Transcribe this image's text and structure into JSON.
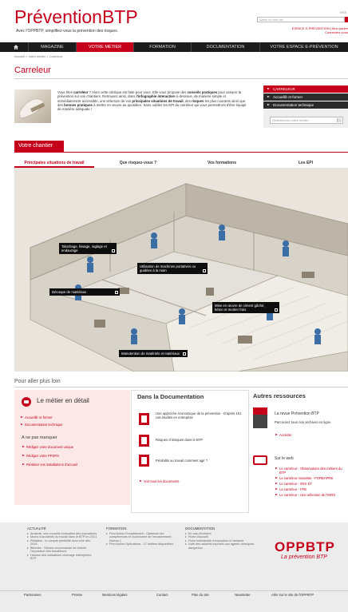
{
  "header": {
    "logo": "PréventionBTP",
    "tagline": "Avec l'OPPBTP, simplifiez-vous la prévention des risques.",
    "user_text": "RSS",
    "search_placeholder": "Saisir un mot clé",
    "link_espace": "ESPACE E-PRÉVENTION",
    "link_mon_panier": "Mon panier",
    "link_connectez": "Connectez-vous"
  },
  "nav": {
    "items": [
      {
        "label": ""
      },
      {
        "label": "MAGAZINE"
      },
      {
        "label": "VOTRE MÉTIER"
      },
      {
        "label": "FORMATION"
      },
      {
        "label": "DOCUMENTATION"
      },
      {
        "label": "VOTRE ESPACE E-PRÉVENTION"
      }
    ],
    "active_color": "#c5001b"
  },
  "breadcrumb": "Accueil > Votre métier > Carreleur",
  "page_title": "Carreleur",
  "intro": {
    "p1": "Vous êtes ",
    "b1": "carreleur",
    "p2": " ? Alors cette rubrique est faite pour vous. Elle vous propose des ",
    "b2": "conseils pratiques",
    "p3": " pour assurer la prévention sur vos chantiers. Retrouvez ainsi, dans ",
    "b3": "l'infographie interactive",
    "p4": " ci-dessous, de manière simple et immédiatement accessible, une sélection de vos ",
    "b4": "principales situations de travail",
    "p5": ", des ",
    "b5": "risques",
    "p6": " les plus courants ainsi que des ",
    "b6": "bonnes pratiques",
    "p7": " à mettre en œuvre au quotidien. Sans oublier les EPI du carreleur qui vous permettront d'être équipé de manière adéquate !"
  },
  "side_menu": {
    "items": [
      "CARRELEUR",
      "Accueillir et former",
      "Documentation technique"
    ],
    "select_placeholder": "Sélectionnez votre métier"
  },
  "chantier": {
    "title": "Votre chantier",
    "tabs": [
      "Principales situations de travail",
      "Que risquez-vous ?",
      "Vos formations",
      "Les EPI"
    ]
  },
  "infographic": {
    "labels": [
      "Talochage, lissage, raglage et endaurage",
      "Utilisation de machines portatives ou guidées à la main",
      "Découpe de matériaux",
      "Mise en œuvre de ciment gâché, béton et mortier frais",
      "Manutention de matériels et matériaux"
    ]
  },
  "pour_aller": "Pour aller plus loin",
  "metier": {
    "title": "Le métier en détail",
    "links": [
      "Accueillir et former",
      "Documentation technique"
    ],
    "ne_pas": "A ne pas manquer",
    "items": [
      "Rédigez votre document unique",
      "Rédigez votre PPSPS",
      "Réalisez vos installations d'accueil"
    ]
  },
  "documentation": {
    "title": "Dans la Documentation",
    "items": [
      "Une approche économique de la prévention - D'après 101 cas étudiés en entreprise",
      "Risques chimiques dans le BTP",
      "Pénibilité au travail comment agir ?"
    ],
    "voir_tous": "Voir tous les documents"
  },
  "ressources": {
    "title": "Autres ressources",
    "revue_title": "La revue Prévention BTP",
    "revue_text": "Parcourez tous nos archives en ligne",
    "acceder": "Accéder",
    "web_title": "Sur le web",
    "web_links": [
      "Le carreleur - Observatoire des métiers du BTP",
      "Le carreleur mosaïste - FORBAPRE",
      "Le carreleur - IRIS-ST",
      "Le carreleur - FFB",
      "Le carreleur - Une sélection de l'INRS"
    ]
  },
  "footer": {
    "actualite": {
      "title": "ACTUALITÉ",
      "items": [
        "Amiante, une nouvelle évaluation des expositions",
        "Moins d'accidents du travail dans le BTP en 2013",
        "Retraites : le compte pénibilité sera créé dès 2015",
        "Bitumes : l'Anses recommande de réduire l'exposition des travailleurs",
        "Hausse des cotisations chômage intempéries BTP"
      ]
    },
    "formation": {
      "title": "FORMATION",
      "items": [
        "Prev'Action Encadrement - Optimiser les compétences et l'autonomie de l'encadrement - Niveau 1",
        "Prev'Action Opérateurs - 27 métiers disponibles"
      ]
    },
    "documentation": {
      "title": "DOCUMENTATION",
      "items": [
        "En cas d'incident",
        "Fiche d'accueil",
        "Fiche individuelle d'exposition à l'amiante",
        "Liste des salariés exposés aux agents chimiques dangereux"
      ]
    },
    "brand": "OPPBTP",
    "brand_sub": "La prévention BTP",
    "bar": [
      "Partenaires",
      "Presse",
      "Mentions légales",
      "Contact",
      "Plan du site",
      "Newsletter",
      "Aller sur le site de l'OPPBTP"
    ]
  }
}
